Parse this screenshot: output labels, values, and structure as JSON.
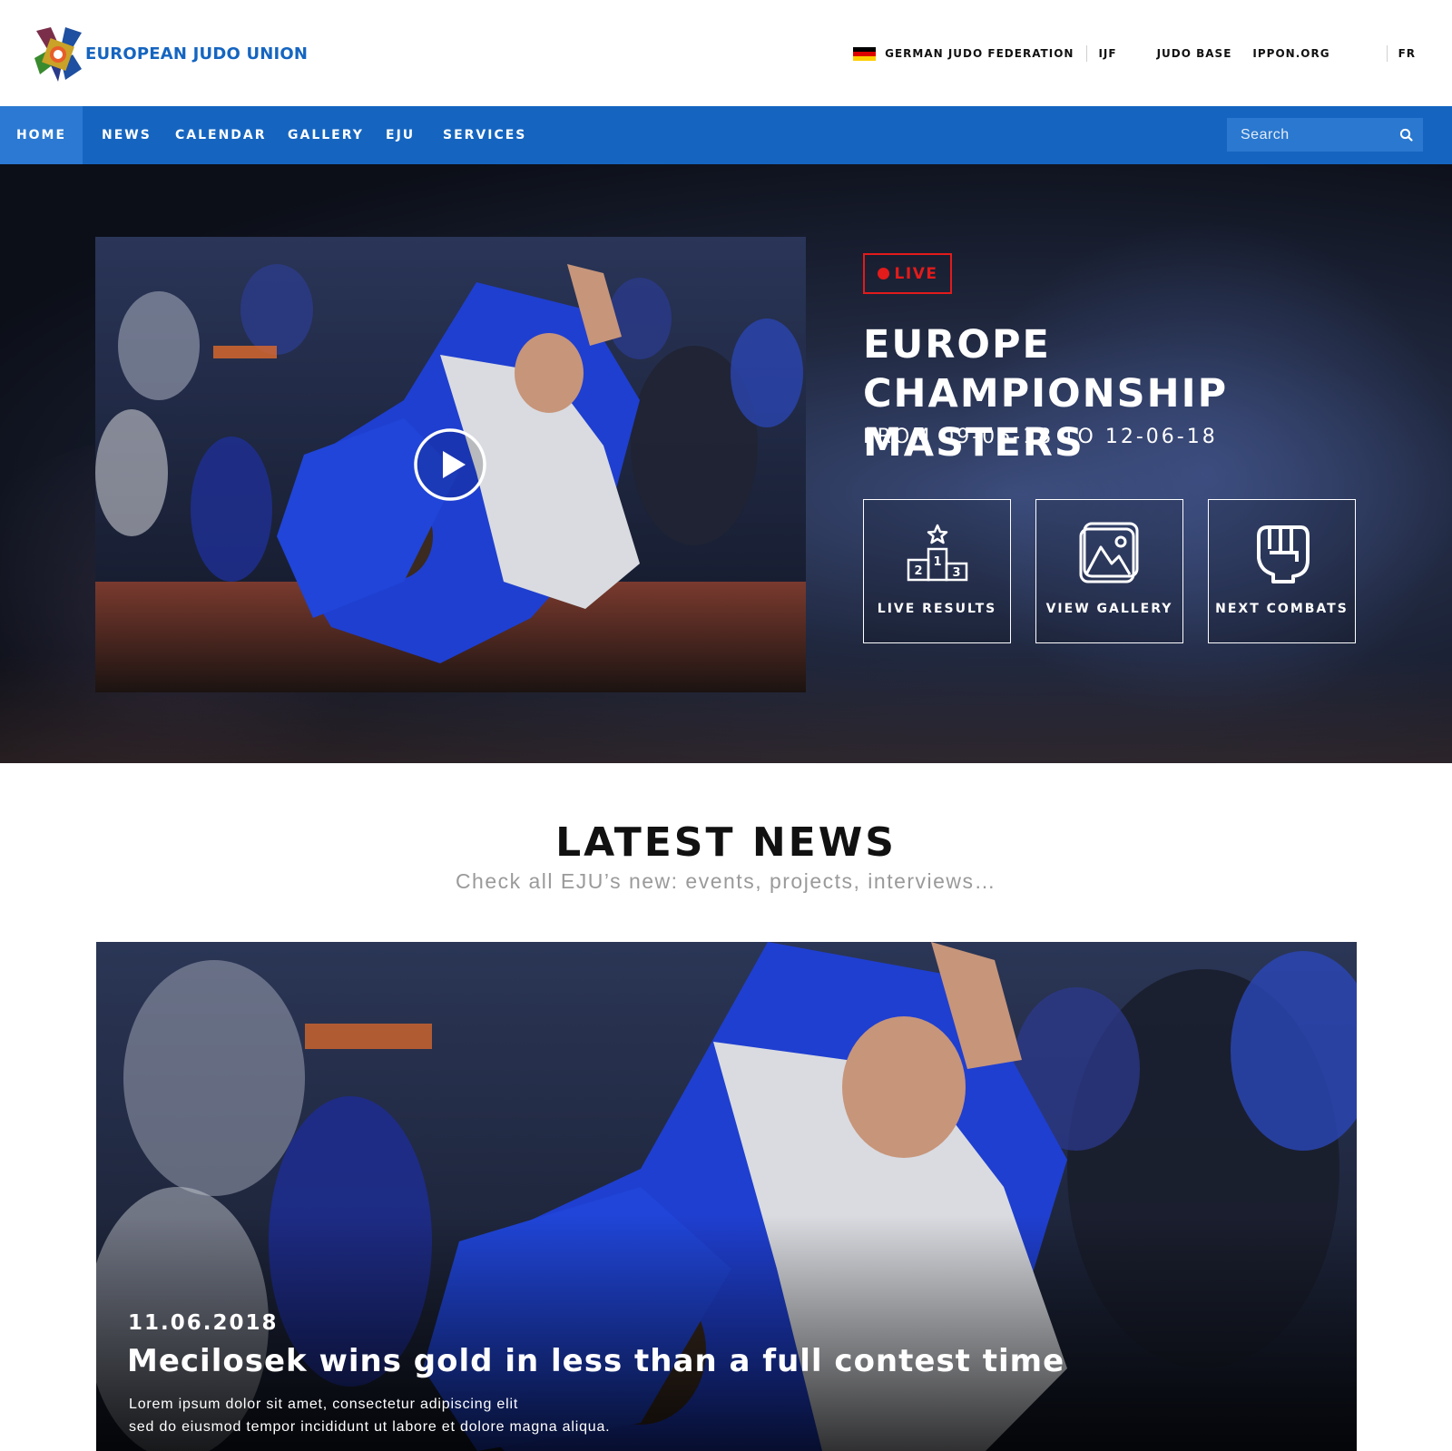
{
  "header": {
    "brand": "EUROPEAN JUDO UNION",
    "links": [
      "GERMAN JUDO FEDERATION",
      "IJF",
      "JUDO BASE",
      "IPPON.ORG"
    ],
    "language": "FR",
    "flag_colors": [
      "#000000",
      "#dd0000",
      "#ffce00"
    ]
  },
  "nav": {
    "items": [
      "HOME",
      "NEWS",
      "CALENDAR",
      "GALLERY",
      "EJU",
      "SERVICES"
    ],
    "active": "HOME",
    "search_placeholder": "Search"
  },
  "hero": {
    "live_label": "LIVE",
    "title_line1": "EUROPE CHAMPIONSHIP",
    "title_line2": "MASTERS",
    "dates": "FROM 09-06-18 TO 12-06-18",
    "actions": [
      {
        "label": "LIVE RESULTS",
        "icon": "podium-icon"
      },
      {
        "label": "VIEW GALLERY",
        "icon": "gallery-icon"
      },
      {
        "label": "NEXT COMBATS",
        "icon": "fist-icon"
      }
    ]
  },
  "news": {
    "heading": "LATEST NEWS",
    "subheading": "Check all EJU’s new: events, projects, interviews…",
    "featured": {
      "date": "11.06.2018",
      "title": "Mecilosek wins gold in less than a full contest time",
      "excerpt_line1": "Lorem ipsum dolor sit amet, consectetur adipiscing elit",
      "excerpt_line2": "sed do eiusmod tempor incididunt ut labore et dolore magna aliqua."
    }
  },
  "colors": {
    "primary": "#1565c0",
    "nav_active": "#2b79d2",
    "live": "#e21b1b",
    "subtext": "#9a9a9a"
  }
}
